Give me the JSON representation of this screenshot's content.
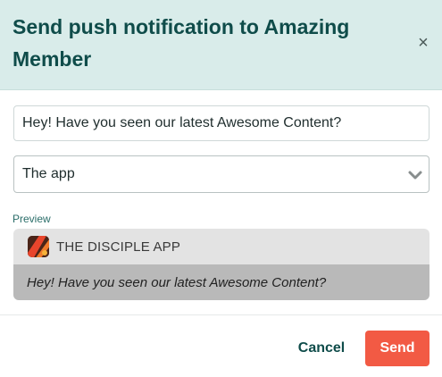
{
  "modal": {
    "title": "Send push notification to Amazing Member",
    "close_icon": "close-icon",
    "close_glyph": "×"
  },
  "form": {
    "message_value": "Hey! Have you seen our latest Awesome Content?",
    "app_select_value": "The app",
    "app_select_icon": "chevron-down-icon"
  },
  "preview": {
    "label": "Preview",
    "app_name": "THE DISCIPLE APP",
    "message": "Hey! Have you seen our latest Awesome Content?",
    "app_icon": "app-logo-icon"
  },
  "footer": {
    "cancel_label": "Cancel",
    "send_label": "Send"
  },
  "colors": {
    "header_bg": "#d9ecea",
    "title": "#0f4c4a",
    "send_bg": "#f25a44",
    "preview_top_bg": "#e3e3e3",
    "preview_bottom_bg": "#b9b9b9"
  }
}
